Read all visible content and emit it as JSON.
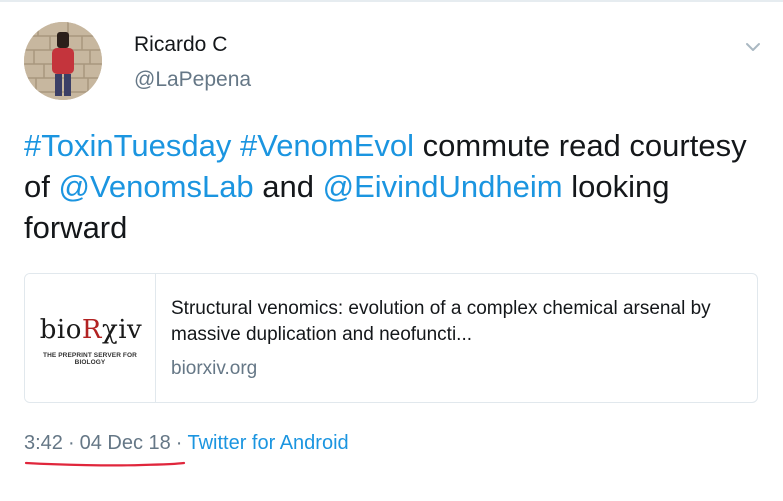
{
  "user": {
    "display_name": "Ricardo C",
    "handle": "@LaPepena"
  },
  "tweet": {
    "hashtag_1": "#ToxinTuesday",
    "hashtag_2": "#VenomEvol",
    "text_1": " commute read courtesy of ",
    "mention_1": "@VenomsLab",
    "text_2": " and ",
    "mention_2": "@EivindUndheim",
    "text_3": " looking forward"
  },
  "card": {
    "logo_part_1": "bio",
    "logo_part_2": "R",
    "logo_part_3": "χiv",
    "logo_tagline": "THE PREPRINT SERVER FOR BIOLOGY",
    "title": "Structural venomics: evolution of a complex chemical arsenal by massive duplication and neofuncti...",
    "domain": "biorxiv.org"
  },
  "meta": {
    "time": "3:42",
    "separator": "·",
    "date": "04 Dec 18",
    "source": "Twitter for Android"
  },
  "icons": {
    "menu": "chevron-down-icon",
    "annotation": "red-underline-mark"
  },
  "colors": {
    "link": "#1b95e0",
    "secondary_text": "#657786",
    "annotation": "#e0263c"
  }
}
